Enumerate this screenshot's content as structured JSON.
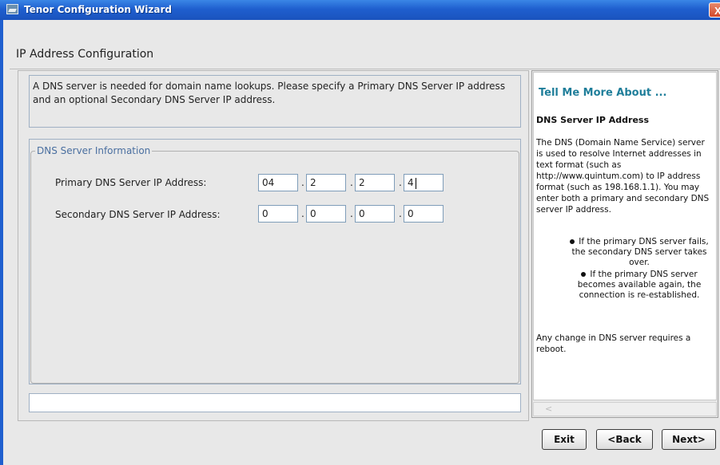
{
  "window": {
    "title": "Tenor Configuration Wizard",
    "close_symbol": "X",
    "app_icon": "tenor-app-icon"
  },
  "page": {
    "heading": "IP Address Configuration"
  },
  "description": "A DNS server is needed for domain name lookups. Please specify a Primary DNS Server IP address and an optional Secondary DNS Server IP address.",
  "dns_group": {
    "legend": "DNS Server Information",
    "primary": {
      "label": "Primary DNS Server IP Address:",
      "octets": [
        "04",
        "2",
        "2",
        "4"
      ]
    },
    "secondary": {
      "label": "Secondary DNS Server IP Address:",
      "octets": [
        "0",
        "0",
        "0",
        "0"
      ]
    },
    "separator": "."
  },
  "status_text": "",
  "help": {
    "heading": "Tell Me More About ...",
    "subheading": "DNS Server IP Address",
    "paragraph": "The DNS (Domain Name Service) server is used to resolve Internet addresses in text format (such as http://www.quintum.com) to IP address format (such as 198.168.1.1). You may enter both a primary and secondary DNS server IP address.",
    "bullets": [
      "If the primary DNS server fails, the secondary DNS server takes over.",
      "If the primary DNS server becomes available again, the connection is re-established."
    ],
    "footer": "Any change in DNS server requires a reboot.",
    "scroll_arrow": "<"
  },
  "buttons": {
    "exit": "Exit",
    "back": "<Back",
    "next": "Next>"
  }
}
